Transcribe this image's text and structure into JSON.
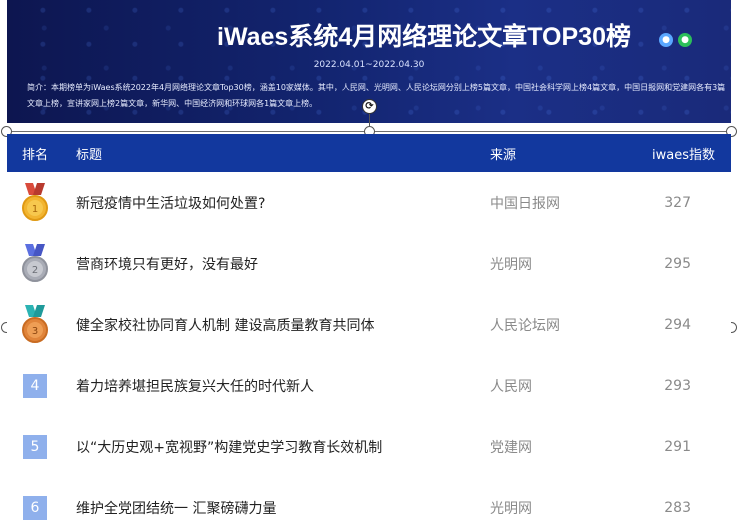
{
  "banner": {
    "title": "iWaes系统4月网络理论文章TOP30榜",
    "icons": [
      "drop-icon",
      "wechat-icon"
    ],
    "date_range": "2022.04.01~2022.04.30",
    "intro": "简介：本期榜单为iWaes系统2022年4月网络理论文章Top30榜，涵盖10家媒体。其中，人民网、光明网、人民论坛网分别上榜5篇文章，中国社会科学网上榜4篇文章，中国日报网和党建网各有3篇文章上榜，宣讲家网上榜2篇文章，新华网、中国经济网和环球网各1篇文章上榜。"
  },
  "table": {
    "headers": {
      "rank": "排名",
      "title": "标题",
      "source": "来源",
      "score": "iwaes指数"
    },
    "rows": [
      {
        "rank": "1",
        "medal": "gold",
        "title": "新冠疫情中生活垃圾如何处置?",
        "source": "中国日报网",
        "score": "327"
      },
      {
        "rank": "2",
        "medal": "silver",
        "title": "营商环境只有更好，没有最好",
        "source": "光明网",
        "score": "295"
      },
      {
        "rank": "3",
        "medal": "bronze",
        "title": "健全家校社协同育人机制 建设高质量教育共同体",
        "source": "人民论坛网",
        "score": "294"
      },
      {
        "rank": "4",
        "title": "着力培养堪担民族复兴大任的时代新人",
        "source": "人民网",
        "score": "293"
      },
      {
        "rank": "5",
        "title": "以“大历史观+宽视野”构建党史学习教育长效机制",
        "source": "党建网",
        "score": "291"
      },
      {
        "rank": "6",
        "title": "维护全党团结统一 汇聚磅礴力量",
        "source": "光明网",
        "score": "283"
      }
    ]
  },
  "colors": {
    "header_bg": "#12389e",
    "banner_bg": "#132571",
    "rank_box": "#8fb0ec",
    "gold": "#f2b531",
    "silver": "#a9acb6",
    "bronze": "#e0843a"
  }
}
